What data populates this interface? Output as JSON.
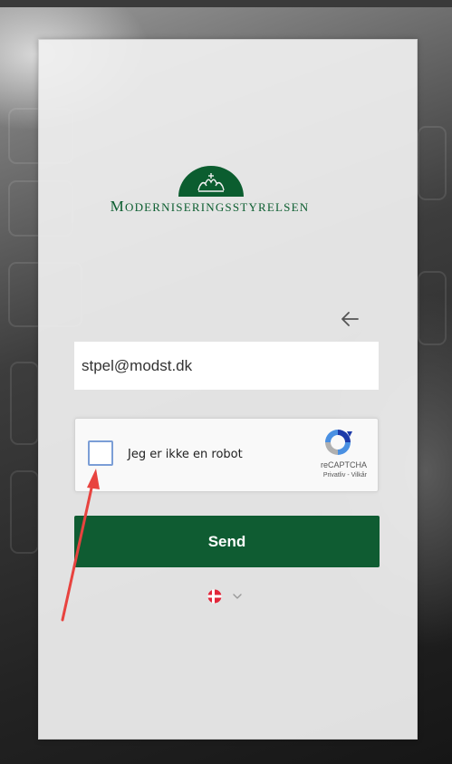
{
  "login": {
    "logo_text_first": "M",
    "logo_text_rest": "ODERNISERINGSSTYRELSEN",
    "back_icon": "arrow-left-icon",
    "email_value": "stpel@modst.dk"
  },
  "recaptcha": {
    "label": "Jeg er ikke en robot",
    "brand": "reCAPTCHA",
    "privacy": "Privatliv",
    "separator": " - ",
    "terms": "Vilkår"
  },
  "actions": {
    "send_label": "Send"
  },
  "language": {
    "selected_flag": "denmark-flag-icon",
    "dropdown_icon": "chevron-down-icon"
  },
  "colors": {
    "brand_green": "#0f5c32",
    "annotation_arrow": "#e8433f"
  }
}
